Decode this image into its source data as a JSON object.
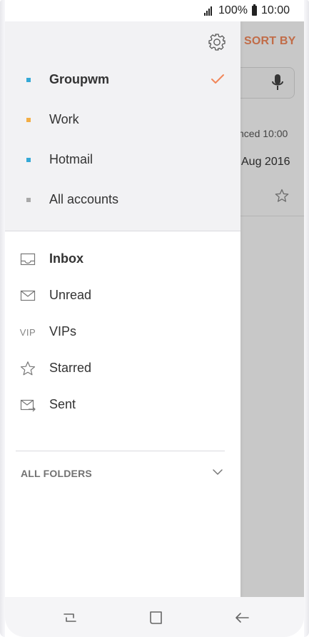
{
  "status_bar": {
    "battery_percent": "100%",
    "time": "10:00",
    "signal_icon": "signal-icon",
    "battery_icon": "battery-icon"
  },
  "background": {
    "sort_label": "SORT BY",
    "sync_text": "nced 10:00",
    "date_text": "Aug 2016",
    "accent_color": "#f2875a"
  },
  "drawer": {
    "settings_icon": "gear-icon",
    "accounts": [
      {
        "label": "Groupwm",
        "selected": true,
        "dot_color": "#35a9d6"
      },
      {
        "label": "Work",
        "selected": false,
        "dot_color": "#f3ae45"
      },
      {
        "label": "Hotmail",
        "selected": false,
        "dot_color": "#35a9d6"
      },
      {
        "label": "All accounts",
        "selected": false,
        "dot_color": "#a9a9a9"
      }
    ],
    "folders": [
      {
        "label": "Inbox",
        "icon": "inbox-icon",
        "bold": true
      },
      {
        "label": "Unread",
        "icon": "mail-icon",
        "bold": false
      },
      {
        "label": "VIPs",
        "icon": "vip-icon",
        "icon_text": "VIP",
        "bold": false
      },
      {
        "label": "Starred",
        "icon": "star-icon",
        "bold": false
      },
      {
        "label": "Sent",
        "icon": "sent-icon",
        "bold": false
      }
    ],
    "all_folders_label": "ALL FOLDERS"
  },
  "navigation_bar": {
    "back_icon": "back-icon",
    "home_icon": "home-icon",
    "recent_icon": "recent-apps-icon"
  }
}
